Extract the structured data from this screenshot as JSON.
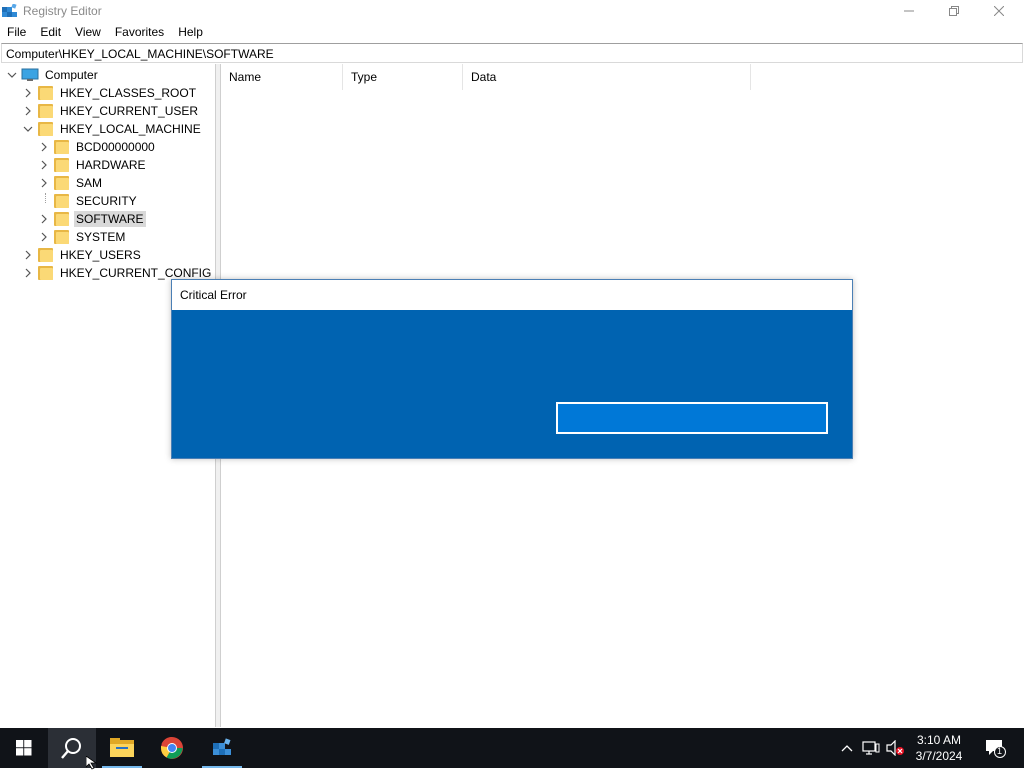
{
  "window": {
    "title": "Registry Editor"
  },
  "menu": [
    "File",
    "Edit",
    "View",
    "Favorites",
    "Help"
  ],
  "address": "Computer\\HKEY_LOCAL_MACHINE\\SOFTWARE",
  "tree": {
    "root": "Computer",
    "hives": [
      "HKEY_CLASSES_ROOT",
      "HKEY_CURRENT_USER",
      "HKEY_LOCAL_MACHINE",
      "HKEY_USERS",
      "HKEY_CURRENT_CONFIG"
    ],
    "hklm_children": [
      "BCD00000000",
      "HARDWARE",
      "SAM",
      "SECURITY",
      "SOFTWARE",
      "SYSTEM"
    ],
    "selected": "SOFTWARE"
  },
  "list": {
    "columns": [
      "Name",
      "Type",
      "Data"
    ]
  },
  "dialog": {
    "title": "Critical Error",
    "background": "#0063b1"
  },
  "taskbar": {
    "time": "3:10 AM",
    "date": "3/7/2024",
    "notification_count": "1",
    "icons": [
      "start-icon",
      "search-icon",
      "file-explorer-icon",
      "chrome-icon",
      "registry-editor-icon"
    ]
  }
}
